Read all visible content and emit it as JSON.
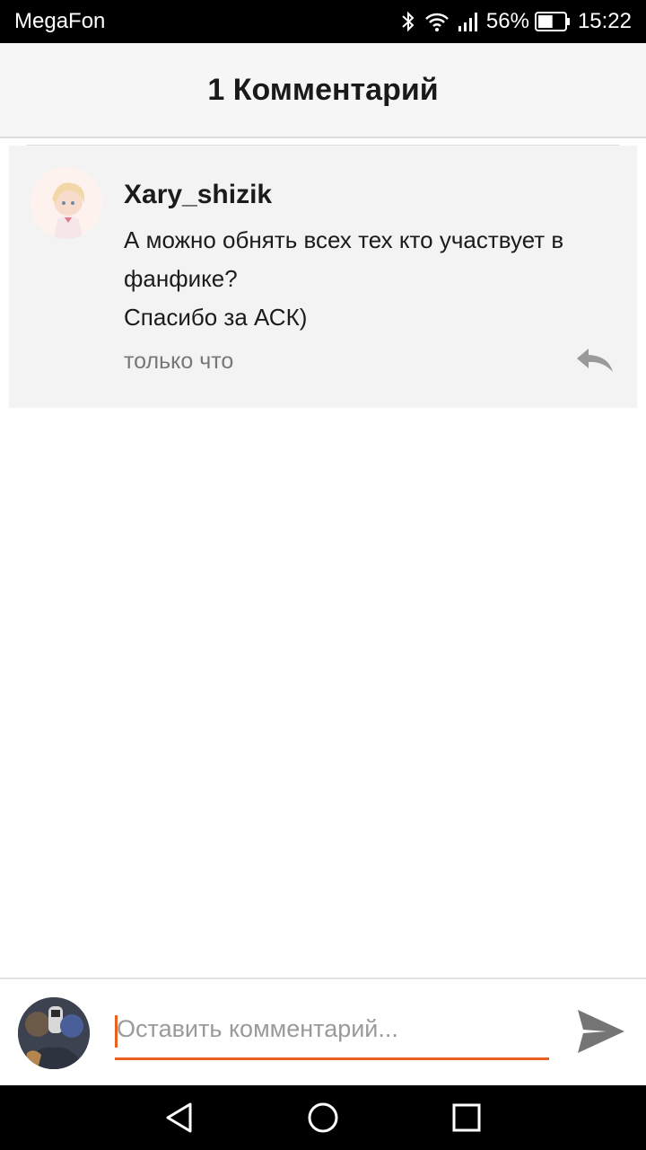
{
  "status_bar": {
    "carrier": "MegaFon",
    "battery": "56%",
    "battery_level": 0.56,
    "time": "15:22",
    "icons": [
      "bluetooth-icon",
      "wifi-icon",
      "signal-icon",
      "battery-icon"
    ]
  },
  "header": {
    "title": "1 Комментарий"
  },
  "comment": {
    "author": "Xary_shizik",
    "lines": [
      "А можно обнять всех тех кто участвует в",
      "фанфике?",
      "Спасибо за АСК)"
    ],
    "time": "только что",
    "reply_icon": "reply-icon"
  },
  "input_bar": {
    "placeholder": "Оставить комментарий...",
    "value": "",
    "send_icon": "send-icon"
  },
  "nav": {
    "icons": [
      "back-icon",
      "home-icon",
      "recent-apps-icon"
    ]
  },
  "colors": {
    "accent": "#e8611f",
    "card_background": "#f3f3f3",
    "header_background": "#f6f6f6"
  }
}
